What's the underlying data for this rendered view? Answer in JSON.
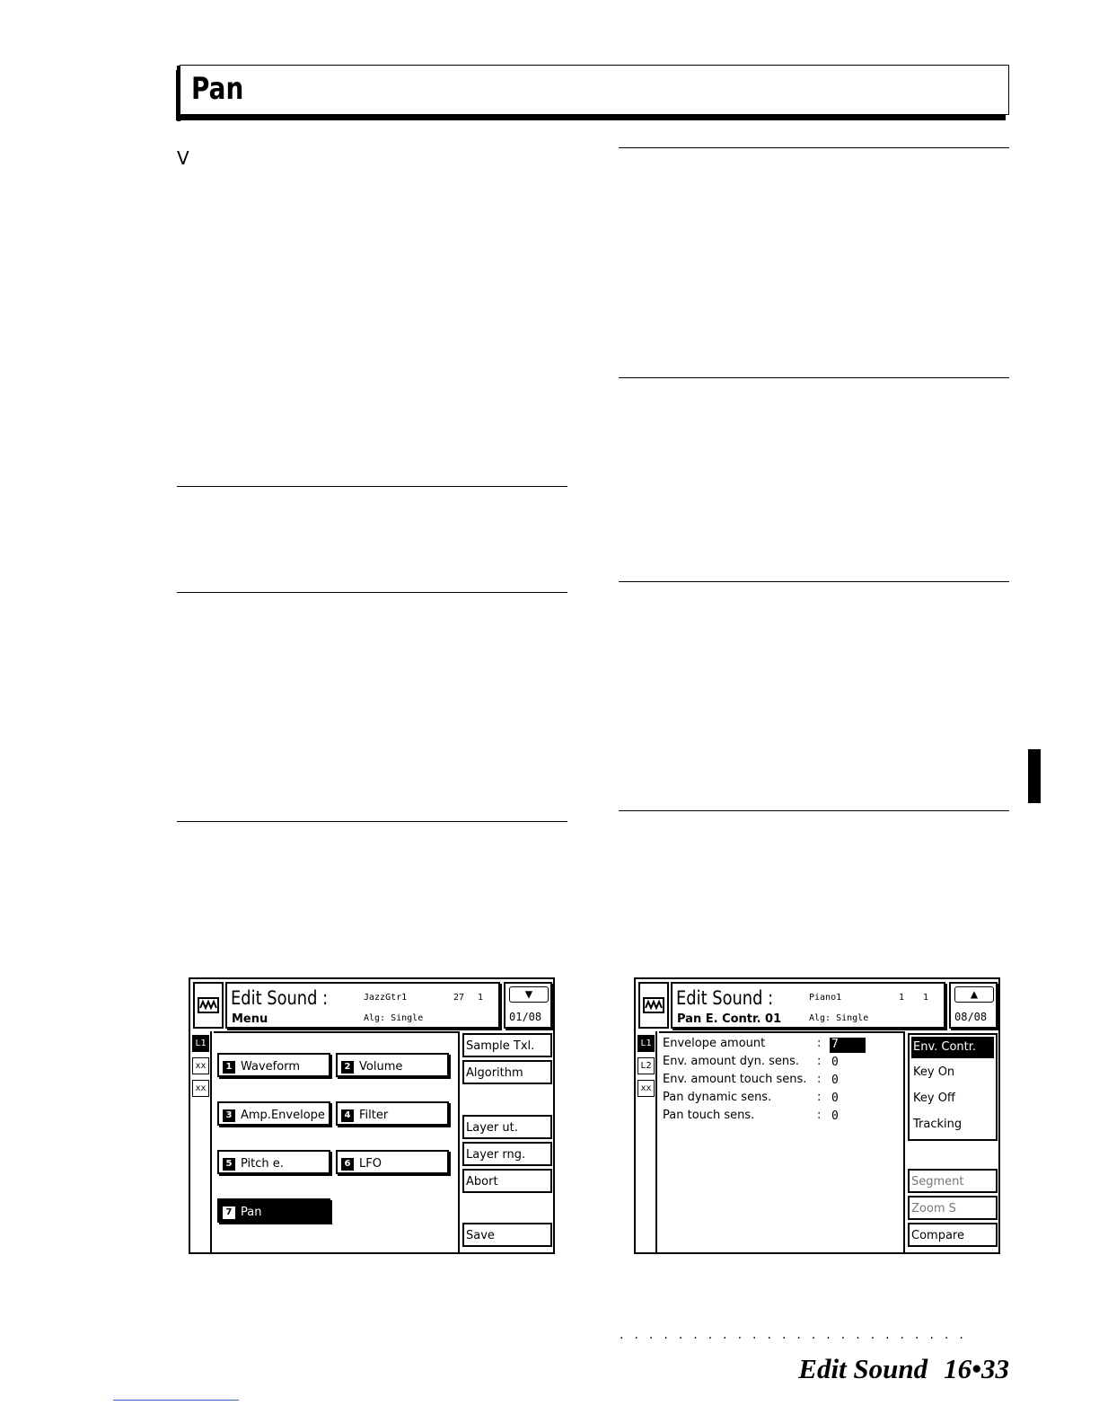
{
  "section": {
    "title": "Pan",
    "stray_letter": "V"
  },
  "screen_menu": {
    "title": "Edit Sound :",
    "subtitle": "Menu",
    "sound_name": "JazzGtr1",
    "sound_num": "27",
    "sound_bank": "1",
    "algorithm": "Alg: Single",
    "page": "01/08",
    "layers": [
      "L1",
      "xx",
      "xx"
    ],
    "buttons": [
      {
        "num": "1",
        "label": "Waveform"
      },
      {
        "num": "2",
        "label": "Volume"
      },
      {
        "num": "3",
        "label": "Amp.Envelope"
      },
      {
        "num": "4",
        "label": "Filter"
      },
      {
        "num": "5",
        "label": "Pitch e."
      },
      {
        "num": "6",
        "label": "LFO"
      },
      {
        "num": "7",
        "label": "Pan"
      }
    ],
    "side": [
      "Sample Txl.",
      "Algorithm",
      "Layer ut.",
      "Layer rng.",
      "Abort",
      "Save"
    ]
  },
  "screen_pan": {
    "title": "Edit Sound :",
    "subtitle": "Pan E. Contr. 01",
    "sound_name": "Piano1",
    "sound_num": "1",
    "sound_bank": "1",
    "algorithm": "Alg: Single",
    "page": "08/08",
    "layers": [
      "L1",
      "L2",
      "xx"
    ],
    "params": [
      {
        "label": "Envelope amount",
        "value": "7"
      },
      {
        "label": "Env. amount dyn. sens.",
        "value": "0"
      },
      {
        "label": "Env. amount touch sens.",
        "value": "0"
      },
      {
        "label": "Pan dynamic sens.",
        "value": "0"
      },
      {
        "label": "Pan touch sens.",
        "value": "0"
      }
    ],
    "env_group": [
      "Env. Contr.",
      "Key On",
      "Key Off",
      "Tracking"
    ],
    "side": [
      "Segment",
      "Zoom S",
      "Compare"
    ]
  },
  "footer": {
    "label": "Edit Sound",
    "page": "16•33"
  }
}
